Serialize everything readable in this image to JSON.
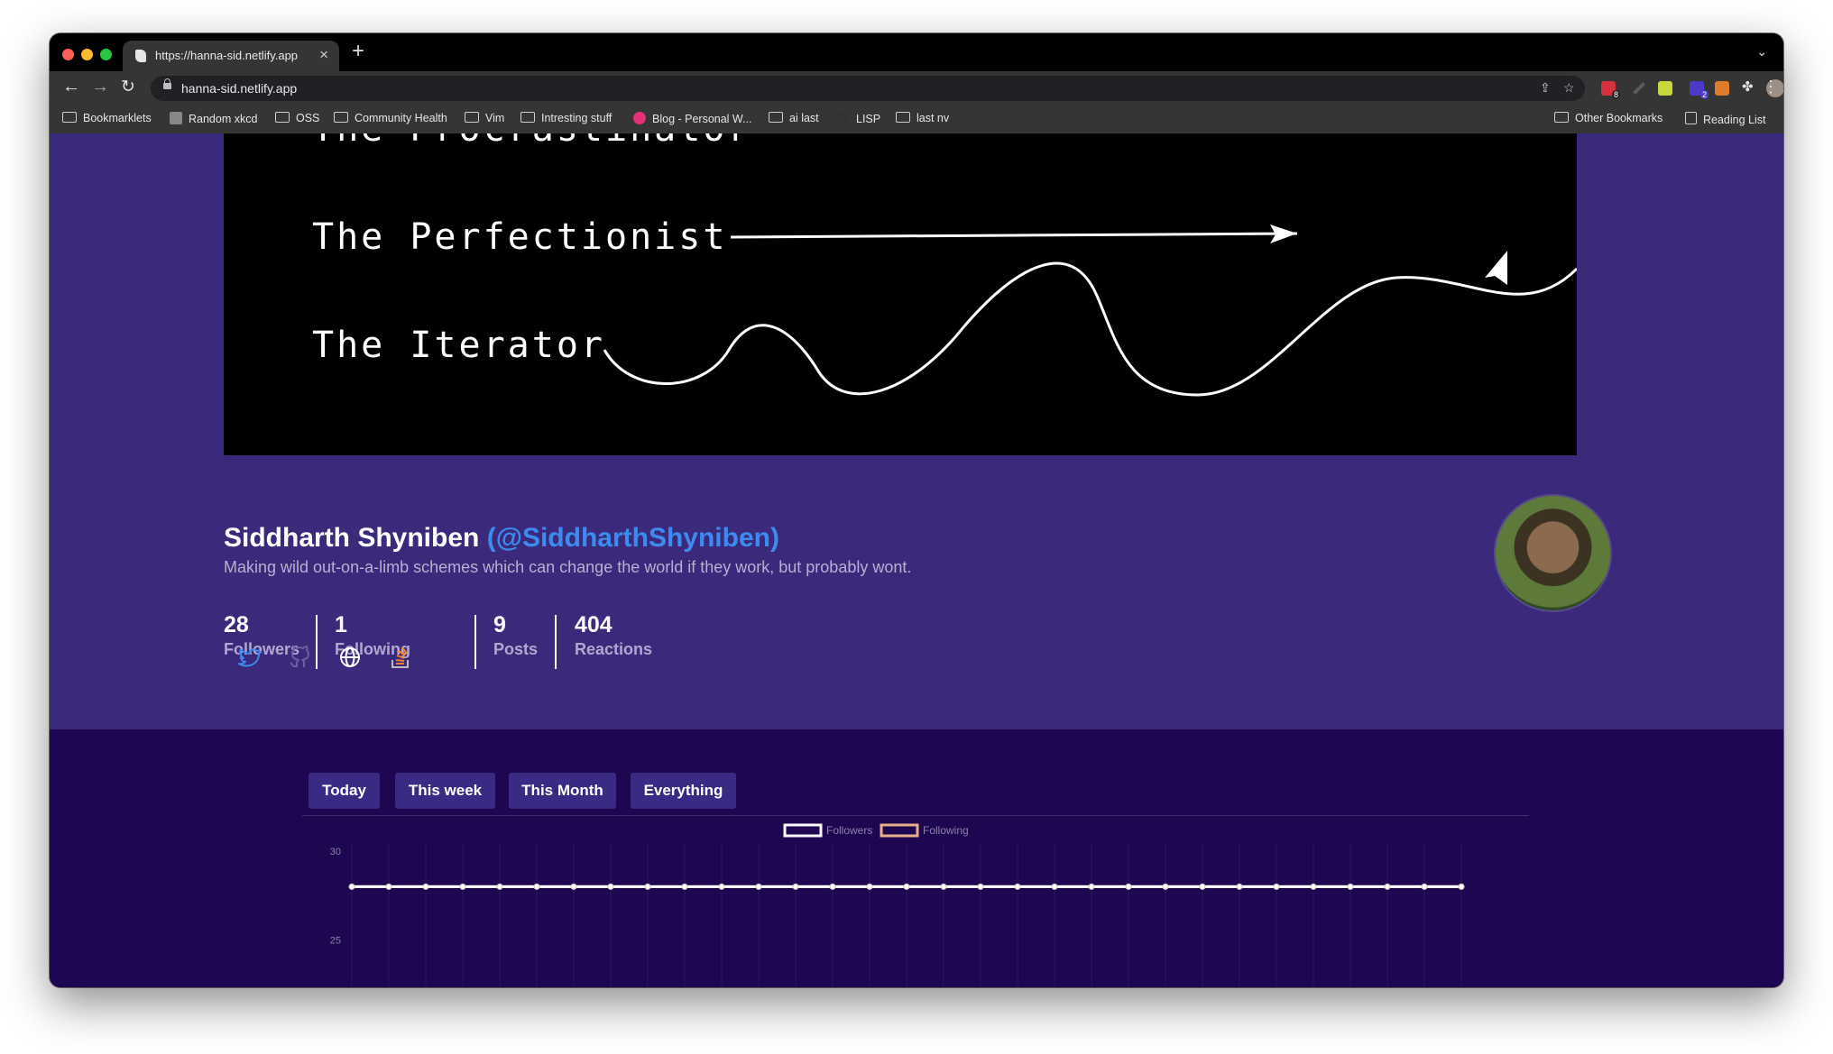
{
  "browser": {
    "tab_title": "https://hanna-sid.netlify.app",
    "url": "hanna-sid.netlify.app",
    "bookmarks": [
      "Bookmarklets",
      "Random xkcd",
      "OSS",
      "Community Health",
      "Vim",
      "Intresting stuff",
      "Blog - Personal W...",
      "ai last",
      "LISP",
      "last nv"
    ],
    "other_bookmarks": "Other Bookmarks",
    "reading_list": "Reading List",
    "extension_badges": [
      "8",
      "2"
    ]
  },
  "banner": {
    "label_top": "The Procrastinator",
    "label_perfectionist": "The Perfectionist",
    "label_iterator": "The Iterator"
  },
  "profile": {
    "name": "Siddharth Shyniben",
    "handle": "(@SiddharthShyniben)",
    "bio": "Making wild out-on-a-limb schemes which can change the world if they work, but probably wont.",
    "stats": [
      {
        "value": "28",
        "label": "Followers"
      },
      {
        "value": "1",
        "label": "Following"
      },
      {
        "value": "9",
        "label": "Posts"
      },
      {
        "value": "404",
        "label": "Reactions"
      }
    ],
    "socials": [
      "twitter-icon",
      "github-icon",
      "globe-icon",
      "stackoverflow-icon"
    ],
    "colors": {
      "accent": "#3c8cf0",
      "section_bg": "#3b2a7b",
      "page_bg": "#1e0651"
    }
  },
  "period_buttons": [
    "Today",
    "This week",
    "This Month",
    "Everything"
  ],
  "chart_data": {
    "type": "line",
    "legend": [
      "Followers",
      "Following"
    ],
    "legend_placement": "top-center",
    "ylim": [
      23,
      30
    ],
    "yticks": [
      "30",
      "25"
    ],
    "series": [
      {
        "name": "Followers",
        "color": "#ffffff",
        "values": [
          28,
          28,
          28,
          28,
          28,
          28,
          28,
          28,
          28,
          28,
          28,
          28,
          28,
          28,
          28,
          28,
          28,
          28,
          28,
          28,
          28,
          28,
          28,
          28,
          28,
          28,
          28,
          28,
          28,
          28,
          28
        ]
      },
      {
        "name": "Following",
        "color": "#e7b08a",
        "values": [
          28,
          28,
          28,
          28,
          28,
          28,
          28,
          28,
          28,
          28,
          28,
          28,
          28,
          28,
          28,
          28,
          28,
          28,
          28,
          28,
          28,
          28,
          28,
          28,
          28,
          28,
          28,
          28,
          28,
          28,
          28
        ]
      }
    ]
  }
}
